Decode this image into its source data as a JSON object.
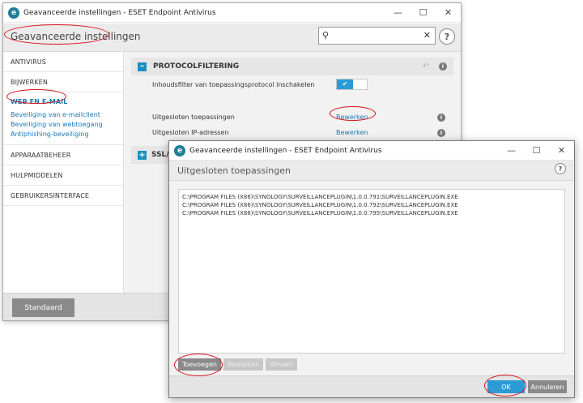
{
  "main_window": {
    "title": "Geavanceerde instellingen - ESET Endpoint Antivirus",
    "header_title": "Geavanceerde instellingen",
    "search_value": "",
    "sidebar": {
      "items": [
        {
          "label": "ANTIVIRUS"
        },
        {
          "label": "BIJWERKEN"
        },
        {
          "label": "WEB EN E-MAIL"
        },
        {
          "label": "APPARAATBEHEER"
        },
        {
          "label": "HULPMIDDELEN"
        },
        {
          "label": "GEBRUIKERSINTERFACE"
        }
      ],
      "sub_items": [
        {
          "label": "Beveiliging van e-mailclient"
        },
        {
          "label": "Beveiliging van webtoegang"
        },
        {
          "label": "Antiphishing-beveiliging"
        }
      ]
    },
    "section": {
      "title": "PROTOCOLFILTERING",
      "toggle_on": true,
      "rows": [
        {
          "label": "Inhoudsfilter van toepassingsprotocol inschakelen"
        },
        {
          "label": "Uitgesloten toepassingen",
          "link": "Bewerken"
        },
        {
          "label": "Uitgesloten IP-adressen",
          "link": "Bewerken"
        }
      ]
    },
    "section2_title": "SSL/T",
    "default_button": "Standaard"
  },
  "dialog": {
    "title": "Geavanceerde instellingen - ESET Endpoint Antivirus",
    "header_title": "Uitgesloten toepassingen",
    "items": [
      "C:\\PROGRAM FILES (X86)\\SYNOLOGY\\SURVEILLANCEPLUGIN\\1.0.0.791\\SURVEILLANCEPLUGIN.EXE",
      "C:\\PROGRAM FILES (X86)\\SYNOLOGY\\SURVEILLANCEPLUGIN\\1.0.0.792\\SURVEILLANCEPLUGIN.EXE",
      "C:\\PROGRAM FILES (X86)\\SYNOLOGY\\SURVEILLANCEPLUGIN\\1.0.0.795\\SURVEILLANCEPLUGIN.EXE"
    ],
    "buttons": {
      "add": "Toevoegen",
      "edit": "Bewerken",
      "remove": "Wissen",
      "ok": "OK",
      "cancel": "Annuleren"
    }
  },
  "icons": {
    "app_logo": "eset-logo-icon",
    "minimize": "minimize-icon",
    "maximize": "maximize-icon",
    "close": "close-icon",
    "search": "search-icon",
    "clear": "clear-icon",
    "help": "help-icon",
    "info": "info-icon",
    "reset": "reset-icon"
  },
  "colors": {
    "accent": "#2b9bd6",
    "link": "#1a77b4",
    "annotation": "#d8141b",
    "button_gray": "#8a8a8a"
  }
}
